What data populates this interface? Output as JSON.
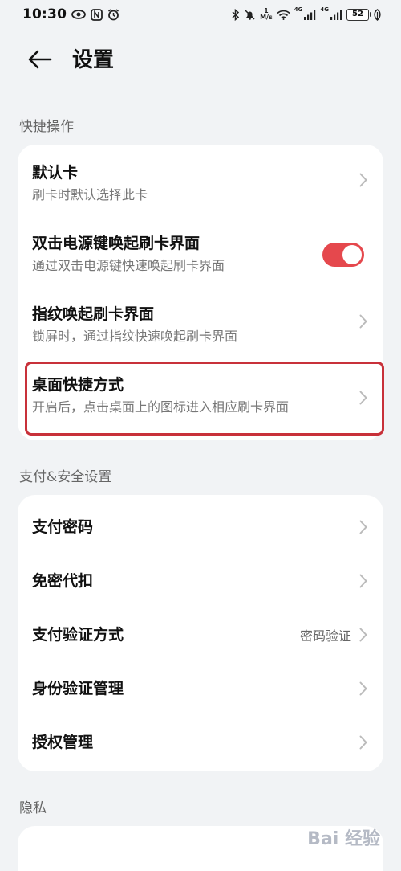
{
  "status_bar": {
    "time": "10:30",
    "speed_top": "1",
    "speed_unit": "M/s",
    "net1": "4G",
    "net2": "4G",
    "battery": "52"
  },
  "header": {
    "title": "设置",
    "back_icon": "arrow-left-icon"
  },
  "sections": {
    "quick": {
      "title": "快捷操作",
      "items": [
        {
          "title": "默认卡",
          "subtitle": "刷卡时默认选择此卡"
        },
        {
          "title": "双击电源键唤起刷卡界面",
          "subtitle": "通过双击电源键快速唤起刷卡界面",
          "toggle_on": true
        },
        {
          "title": "指纹唤起刷卡界面",
          "subtitle": "锁屏时，通过指纹快速唤起刷卡界面"
        },
        {
          "title": "桌面快捷方式",
          "subtitle": "开启后，点击桌面上的图标进入相应刷卡界面"
        }
      ]
    },
    "payment": {
      "title": "支付&安全设置",
      "items": [
        {
          "title": "支付密码"
        },
        {
          "title": "免密代扣"
        },
        {
          "title": "支付验证方式",
          "value": "密码验证"
        },
        {
          "title": "身份验证管理"
        },
        {
          "title": "授权管理"
        }
      ]
    },
    "privacy": {
      "title": "隐私"
    }
  },
  "colors": {
    "toggle_on": "#e5484d",
    "highlight_border": "#c8313a",
    "background": "#f1f3f5"
  },
  "watermark": {
    "text": "Bai 经验"
  }
}
